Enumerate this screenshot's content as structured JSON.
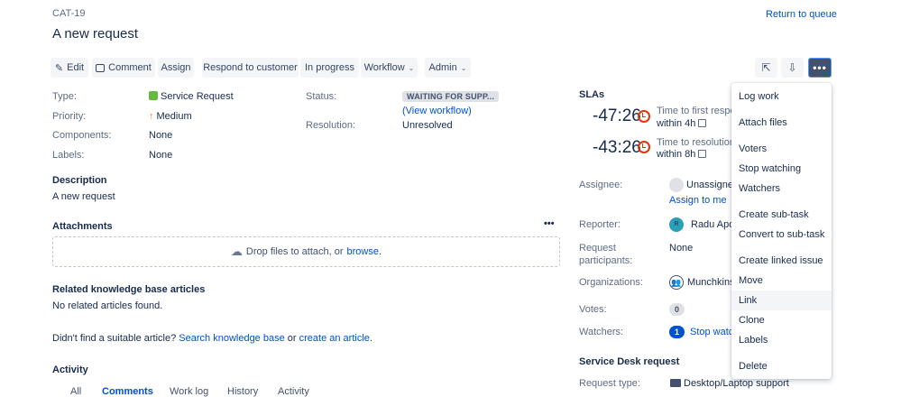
{
  "header": {
    "issue_key": "CAT-19",
    "title": "A new request",
    "return_link": "Return to queue"
  },
  "toolbar": {
    "edit": "Edit",
    "comment": "Comment",
    "assign": "Assign",
    "respond": "Respond to customer",
    "in_progress": "In progress",
    "workflow": "Workflow",
    "admin": "Admin"
  },
  "details": {
    "type_label": "Type:",
    "type_value": "Service Request",
    "priority_label": "Priority:",
    "priority_value": "Medium",
    "components_label": "Components:",
    "components_value": "None",
    "labels_label": "Labels:",
    "labels_value": "None",
    "status_label": "Status:",
    "status_value": "WAITING FOR SUPP...",
    "view_workflow": "(View workflow)",
    "resolution_label": "Resolution:",
    "resolution_value": "Unresolved"
  },
  "description": {
    "heading": "Description",
    "text": "A new request"
  },
  "attachments": {
    "heading": "Attachments",
    "drop_text": "Drop files to attach, or",
    "browse": "browse."
  },
  "kb": {
    "heading": "Related knowledge base articles",
    "empty": "No related articles found.",
    "prompt": "Didn't find a suitable article?",
    "search_link": "Search knowledge base",
    "or": "or",
    "create_link": "create an article",
    "period": "."
  },
  "activity": {
    "heading": "Activity",
    "tabs": [
      "All",
      "Comments",
      "Work log",
      "History",
      "Activity"
    ],
    "active_tab": "Comments"
  },
  "slas": {
    "heading": "SLAs",
    "items": [
      {
        "time": "-47:26",
        "name": "Time to first respon",
        "target": "within 4h"
      },
      {
        "time": "-43:26",
        "name": "Time to resolution",
        "target": "within 8h"
      }
    ]
  },
  "people": {
    "assignee_label": "Assignee:",
    "assignee_value": "Unassigned",
    "assign_to_me": "Assign to me",
    "reporter_label": "Reporter:",
    "reporter_initial": "R",
    "reporter_value": "Radu Apos",
    "participants_label_1": "Request",
    "participants_label_2": "participants:",
    "participants_value": "None",
    "organizations_label": "Organizations:",
    "organizations_value": "Munchkins",
    "votes_label": "Votes:",
    "votes_value": "0",
    "watchers_label": "Watchers:",
    "watchers_value": "1",
    "stop_watching": "Stop watch"
  },
  "service_desk": {
    "heading": "Service Desk request",
    "request_type_label": "Request type:",
    "request_type_value": "Desktop/Laptop support"
  },
  "more_menu": {
    "groups": [
      [
        "Log work"
      ],
      [
        "Attach files"
      ],
      [
        "Voters",
        "Stop watching",
        "Watchers"
      ],
      [
        "Create sub-task",
        "Convert to sub-task"
      ],
      [
        "Create linked issue",
        "Move",
        "Link",
        "Clone",
        "Labels"
      ],
      [
        "Delete"
      ]
    ],
    "highlighted": "Link"
  },
  "colors": {
    "link": "#0052cc",
    "sla_breached": "#de350b",
    "menu_button": "#42526e"
  }
}
